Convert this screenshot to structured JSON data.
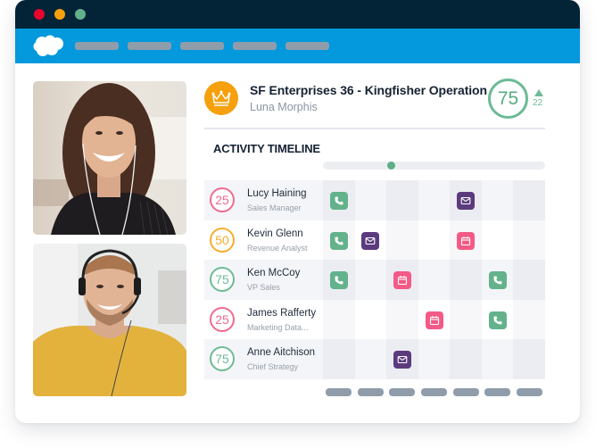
{
  "window": {
    "traffic_lights": [
      "close",
      "minimize",
      "maximize"
    ],
    "colors": {
      "titlebar": "#032337",
      "navbar": "#0399dc",
      "red": "#e8052e",
      "yellow": "#f7a008",
      "green": "#63b18b"
    }
  },
  "navbar": {
    "logo": "salesforce-cloud-icon",
    "placeholder_tab_count": 5
  },
  "photos": [
    {
      "name": "participant-woman-headphones"
    },
    {
      "name": "participant-man-headset"
    }
  ],
  "opportunity": {
    "icon": "crown-icon",
    "title": "SF Enterprises 36 - Kingfisher Operation",
    "owner": "Luna Morphis",
    "score": "75",
    "trend_direction": "up",
    "trend_value": "22"
  },
  "timeline": {
    "title": "ACTIVITY TIMELINE",
    "scroll_position": 0.3,
    "column_count": 7,
    "contacts": [
      {
        "name": "Lucy Haining",
        "role": "Sales Manager",
        "score": "25",
        "score_color": "#f06b8f",
        "activities": [
          {
            "col": 0,
            "type": "call"
          },
          {
            "col": 4,
            "type": "email"
          }
        ]
      },
      {
        "name": "Kevin Glenn",
        "role": "Revenue Analyst",
        "score": "50",
        "score_color": "#f5ae2b",
        "activities": [
          {
            "col": 0,
            "type": "call"
          },
          {
            "col": 1,
            "type": "email"
          },
          {
            "col": 4,
            "type": "meeting"
          }
        ]
      },
      {
        "name": "Ken McCoy",
        "role": "VP Sales",
        "score": "75",
        "score_color": "#6dbb96",
        "activities": [
          {
            "col": 0,
            "type": "call"
          },
          {
            "col": 2,
            "type": "meeting"
          },
          {
            "col": 5,
            "type": "call"
          }
        ]
      },
      {
        "name": "James Rafferty",
        "role": "Marketing Data...",
        "score": "25",
        "score_color": "#f06b8f",
        "activities": [
          {
            "col": 3,
            "type": "meeting"
          },
          {
            "col": 5,
            "type": "call"
          }
        ]
      },
      {
        "name": "Anne Aitchison",
        "role": "Chief Strategy",
        "score": "75",
        "score_color": "#6dbb96",
        "activities": [
          {
            "col": 2,
            "type": "email"
          }
        ]
      }
    ],
    "activity_colors": {
      "call": "#63b28c",
      "email": "#5b3b7d",
      "meeting": "#f45a86"
    },
    "activity_icons": {
      "call": "phone-icon",
      "email": "envelope-icon",
      "meeting": "calendar-icon"
    }
  }
}
